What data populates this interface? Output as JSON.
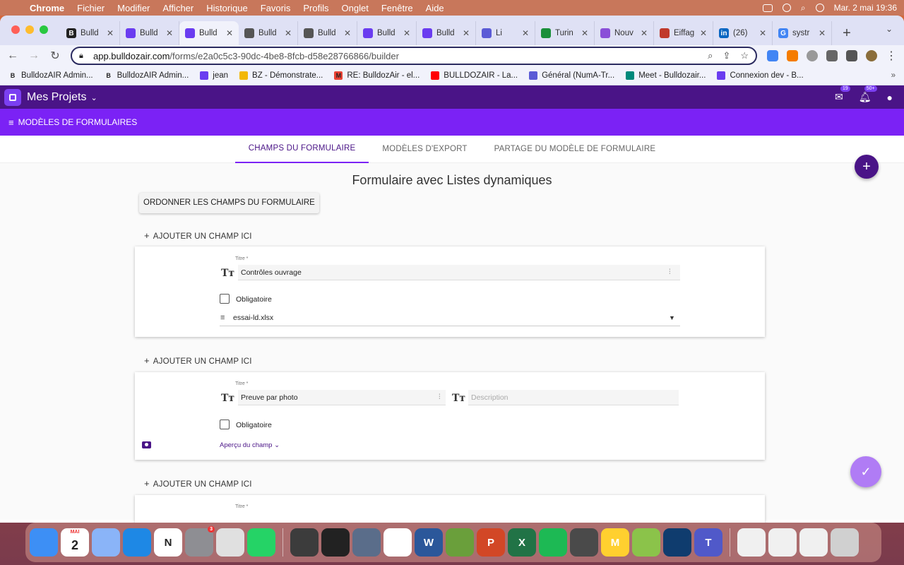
{
  "menubar": {
    "app": "Chrome",
    "items": [
      "Fichier",
      "Modifier",
      "Afficher",
      "Historique",
      "Favoris",
      "Profils",
      "Onglet",
      "Fenêtre",
      "Aide"
    ],
    "clock": "Mar. 2 mai 19:36"
  },
  "tabs": [
    {
      "label": "Bulld",
      "color": "#222222",
      "glyph": "B"
    },
    {
      "label": "Bulld",
      "color": "#6a3cf0",
      "glyph": ""
    },
    {
      "label": "Bulld",
      "color": "#6a3cf0",
      "glyph": "",
      "active": true
    },
    {
      "label": "Bulld",
      "color": "#555555",
      "glyph": ""
    },
    {
      "label": "Bulld",
      "color": "#555555",
      "glyph": ""
    },
    {
      "label": "Bulld",
      "color": "#6a3cf0",
      "glyph": ""
    },
    {
      "label": "Bulld",
      "color": "#6a3cf0",
      "glyph": ""
    },
    {
      "label": "Li",
      "color": "#5b5bd6",
      "glyph": ""
    },
    {
      "label": "Turin",
      "color": "#1a8f3a",
      "glyph": ""
    },
    {
      "label": "Nouv",
      "color": "#8a4fd8",
      "glyph": ""
    },
    {
      "label": "Eiffag",
      "color": "#c0392b",
      "glyph": ""
    },
    {
      "label": "(26)",
      "color": "#0a66c2",
      "glyph": "in"
    },
    {
      "label": "systr",
      "color": "#4285f4",
      "glyph": "G"
    }
  ],
  "omnibox": {
    "host": "app.bulldozair.com",
    "path": "/forms/e2a0c5c3-90dc-4be8-8fcb-d58e28766866/builder"
  },
  "bookmarks": [
    {
      "label": "BulldozAIR Admin...",
      "color": "#222222",
      "glyph": "B"
    },
    {
      "label": "BulldozAIR Admin...",
      "color": "#222222",
      "glyph": "B"
    },
    {
      "label": "jean",
      "color": "#6a3cf0",
      "glyph": ""
    },
    {
      "label": "BZ - Démonstrate...",
      "color": "#f2b705",
      "glyph": ""
    },
    {
      "label": "RE: BulldozAir - el...",
      "color": "#ea4335",
      "glyph": "M"
    },
    {
      "label": "BULLDOZAIR - La...",
      "color": "#ff0000",
      "glyph": ""
    },
    {
      "label": "Général (NumA-Tr...",
      "color": "#5b5bd6",
      "glyph": ""
    },
    {
      "label": "Meet - Bulldozair...",
      "color": "#00897b",
      "glyph": ""
    },
    {
      "label": "Connexion dev - B...",
      "color": "#6a3cf0",
      "glyph": ""
    }
  ],
  "app": {
    "project_selector": "Mes Projets",
    "messages_count": "19",
    "notifications_count": "50+",
    "section_title": "MODÈLES DE FORMULAIRES",
    "tabs": [
      "CHAMPS DU FORMULAIRE",
      "MODÈLES D'EXPORT",
      "PARTAGE DU MODÈLE DE FORMULAIRE"
    ],
    "form_title": "Formulaire avec Listes dynamiques",
    "order_button": "ORDONNER LES CHAMPS DU FORMULAIRE",
    "add_field_label": "AJOUTER UN CHAMP ICI",
    "fields": [
      {
        "title_label": "Titre *",
        "title_value": "Contrôles ouvrage",
        "required_label": "Obligatoire",
        "list_file": "essai-ld.xlsx"
      },
      {
        "title_label": "Titre *",
        "title_value": "Preuve par photo",
        "description_placeholder": "Description",
        "required_label": "Obligatoire",
        "preview_label": "Aperçu du champ"
      },
      {
        "title_label": "Titre *"
      }
    ]
  },
  "dock": [
    {
      "name": "Finder",
      "color": "#3d8ff5"
    },
    {
      "name": "Calendar",
      "color": "#ffffff",
      "text": "2",
      "sub": "MAI"
    },
    {
      "name": "Launchpad",
      "color": "#8ab4f8"
    },
    {
      "name": "App Store",
      "color": "#1e88e5"
    },
    {
      "name": "Notion",
      "color": "#ffffff",
      "text": "N"
    },
    {
      "name": "System Preferences",
      "color": "#8e8e93",
      "badge": "3"
    },
    {
      "name": "Chrome",
      "color": "#e0e0e0"
    },
    {
      "name": "WhatsApp",
      "color": "#25d366"
    },
    {
      "name": "QuickTime",
      "color": "#3c3c3c"
    },
    {
      "name": "Piano",
      "color": "#222222"
    },
    {
      "name": "Preview",
      "color": "#5a6d8a"
    },
    {
      "name": "Slack",
      "color": "#ffffff"
    },
    {
      "name": "Word",
      "color": "#2b579a",
      "text": "W"
    },
    {
      "name": "Garden",
      "color": "#6a9f3b"
    },
    {
      "name": "PowerPoint",
      "color": "#d24726",
      "text": "P"
    },
    {
      "name": "Excel",
      "color": "#217346",
      "text": "X"
    },
    {
      "name": "Spotify",
      "color": "#1db954"
    },
    {
      "name": "Klack",
      "color": "#4a4a4a"
    },
    {
      "name": "Miro",
      "color": "#ffd02f",
      "text": "M"
    },
    {
      "name": "Android",
      "color": "#8bc34a"
    },
    {
      "name": "Outlook",
      "color": "#0f3c6e"
    },
    {
      "name": "Teams",
      "color": "#5059c9",
      "text": "T"
    },
    {
      "name": "Document 1",
      "color": "#f0f0f0"
    },
    {
      "name": "Document 2",
      "color": "#f0f0f0"
    },
    {
      "name": "Document 3",
      "color": "#f0f0f0"
    },
    {
      "name": "Trash",
      "color": "#d0d0d0"
    }
  ]
}
